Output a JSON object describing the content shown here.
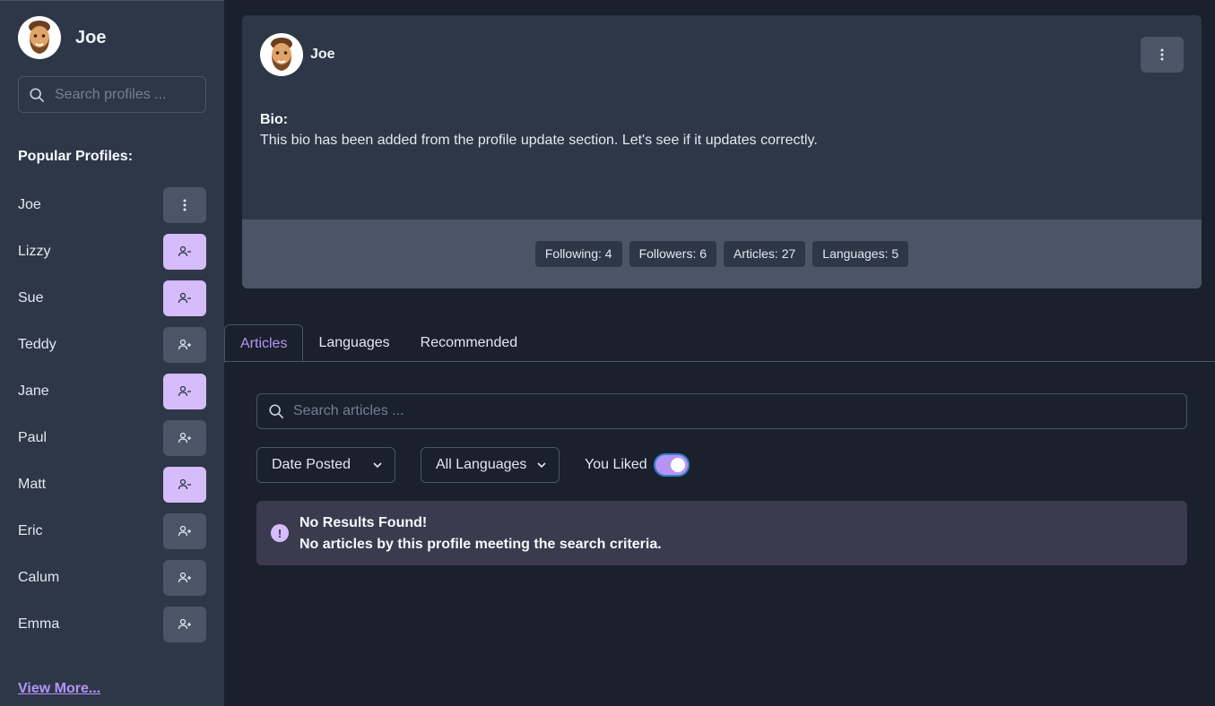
{
  "user": {
    "name": "Joe"
  },
  "sidebar": {
    "search_placeholder": "Search profiles ...",
    "popular_title": "Popular Profiles:",
    "profiles": [
      {
        "name": "Joe",
        "action": "menu"
      },
      {
        "name": "Lizzy",
        "action": "unfollow"
      },
      {
        "name": "Sue",
        "action": "unfollow"
      },
      {
        "name": "Teddy",
        "action": "follow"
      },
      {
        "name": "Jane",
        "action": "unfollow"
      },
      {
        "name": "Paul",
        "action": "follow"
      },
      {
        "name": "Matt",
        "action": "unfollow"
      },
      {
        "name": "Eric",
        "action": "follow"
      },
      {
        "name": "Calum",
        "action": "follow"
      },
      {
        "name": "Emma",
        "action": "follow"
      }
    ],
    "view_more": "View More..."
  },
  "profile": {
    "name": "Joe",
    "bio_label": "Bio:",
    "bio_text": "This bio has been added from the profile update section. Let's see if it updates correctly.",
    "stats": [
      "Following: 4",
      "Followers: 6",
      "Articles: 27",
      "Languages: 5"
    ]
  },
  "tabs": [
    {
      "label": "Articles",
      "active": true
    },
    {
      "label": "Languages",
      "active": false
    },
    {
      "label": "Recommended",
      "active": false
    }
  ],
  "articles": {
    "search_placeholder": "Search articles ...",
    "sort_selected": "Date Posted",
    "language_selected": "All Languages",
    "liked_label": "You Liked",
    "liked_on": true,
    "alert_title": "No Results Found!",
    "alert_desc": "No articles by this profile meeting the search criteria."
  },
  "colors": {
    "accent": "#b794f4",
    "following_button": "#d6bcfa",
    "background": "#1a202c",
    "panel": "#2d3748"
  }
}
